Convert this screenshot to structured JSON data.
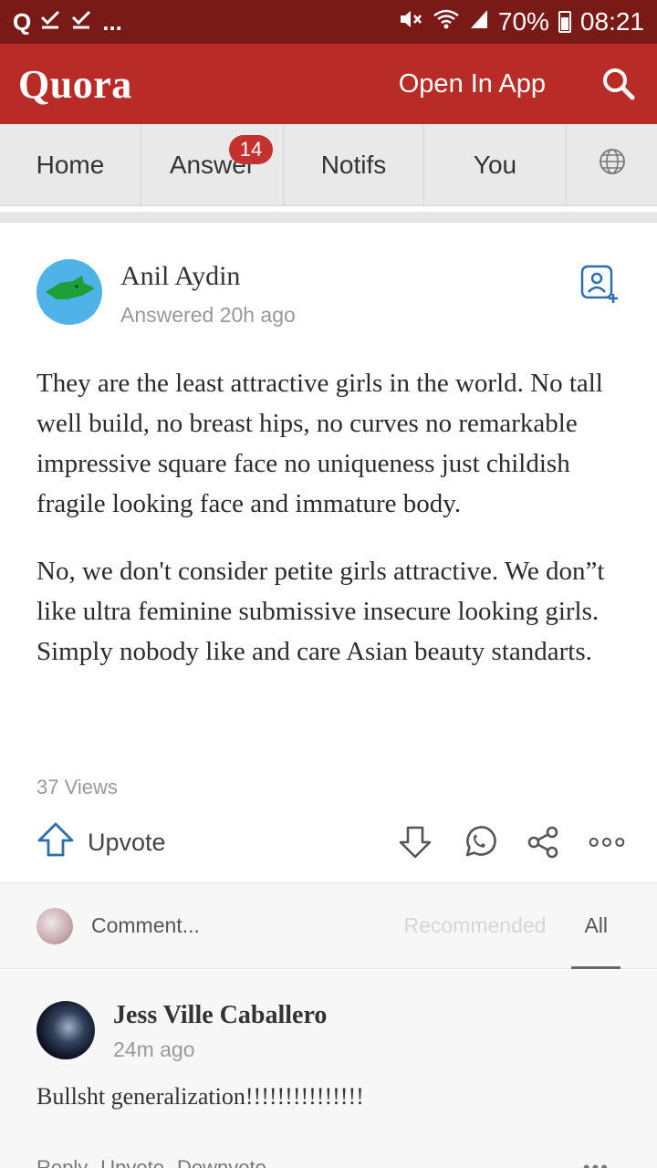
{
  "status_bar": {
    "left_icons": [
      "quora-notification-icon",
      "check-icon",
      "check-icon"
    ],
    "left_q": "Q",
    "left_more": "...",
    "battery": "70%",
    "time": "08:21"
  },
  "header": {
    "logo": "Quora",
    "open_in_app": "Open In App"
  },
  "nav": {
    "home": "Home",
    "answer": "Answer",
    "answer_badge": "14",
    "notifs": "Notifs",
    "you": "You"
  },
  "answer": {
    "author_name": "Anil Aydin",
    "answered": "Answered 20h ago",
    "paragraphs": [
      "They are the least attractive girls in the world. No tall well build, no breast hips, no curves no remarkable impressive square face no uniqueness just childish fragile looking face and immature body.",
      "No, we don't consider petite girls attractive. We don”t like ultra feminine submissive insecure looking girls. Simply nobody like and care Asian beauty standarts."
    ],
    "views": "37 Views",
    "upvote_label": "Upvote"
  },
  "comments_bar": {
    "placeholder": "Comment...",
    "recommended": "Recommended",
    "all": "All"
  },
  "comment": {
    "name": "Jess Ville Caballero",
    "time": "24m ago",
    "text": "Bullsht generalization!!!!!!!!!!!!!!!",
    "reply": "Reply",
    "upvote": "Upvote",
    "downvote": "Downvote",
    "more": "•••"
  },
  "colors": {
    "status_bar": "#7a1a17",
    "brand_red": "#b92b27",
    "upvote_blue": "#2b6dad",
    "badge_red": "#c4322e"
  }
}
